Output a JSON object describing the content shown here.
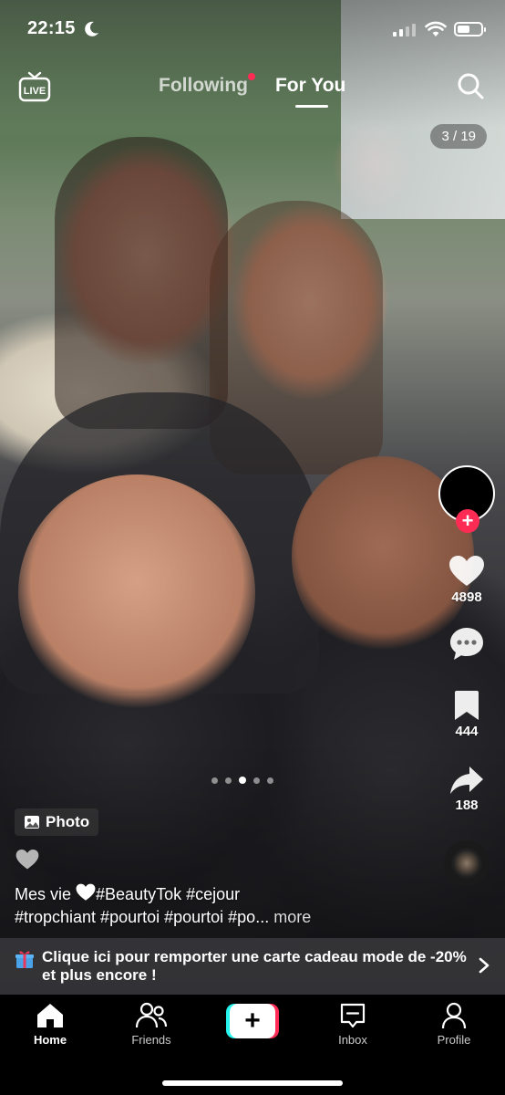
{
  "status_bar": {
    "time": "22:15",
    "icons": [
      "moon-icon",
      "signal-icon",
      "wifi-icon",
      "battery-icon"
    ],
    "battery_level": 0.55
  },
  "top_nav": {
    "live_label": "LIVE",
    "tabs": [
      {
        "label": "Following",
        "active": false,
        "has_notification_dot": true
      },
      {
        "label": "For You",
        "active": true
      }
    ],
    "search_icon": "search-icon"
  },
  "photo_counter": "3 / 19",
  "actions": {
    "likes": "4898",
    "saves": "444",
    "shares": "188",
    "follow_plus": "+"
  },
  "carousel": {
    "total_dots": 5,
    "active_index": 2
  },
  "caption": {
    "badge_label": "Photo",
    "text_prefix": "Mes vie ",
    "text_rest": "#BeautyTok #cejour",
    "line2": "#tropchiant #pourtoi #pourtoi #po...",
    "more_label": " more"
  },
  "promo": {
    "text": "Clique ici pour remporter une carte cadeau mode de -20% et plus encore !"
  },
  "bottom_nav": {
    "items": [
      {
        "label": "Home",
        "icon": "home-icon",
        "active": true
      },
      {
        "label": "Friends",
        "icon": "friends-icon",
        "active": false
      },
      {
        "label": "",
        "icon": "create-icon",
        "active": false
      },
      {
        "label": "Inbox",
        "icon": "inbox-icon",
        "active": false
      },
      {
        "label": "Profile",
        "icon": "profile-icon",
        "active": false
      }
    ],
    "create_symbol": "+"
  },
  "colors": {
    "accent_red": "#fe2c55",
    "accent_cyan": "#25f4ee"
  }
}
